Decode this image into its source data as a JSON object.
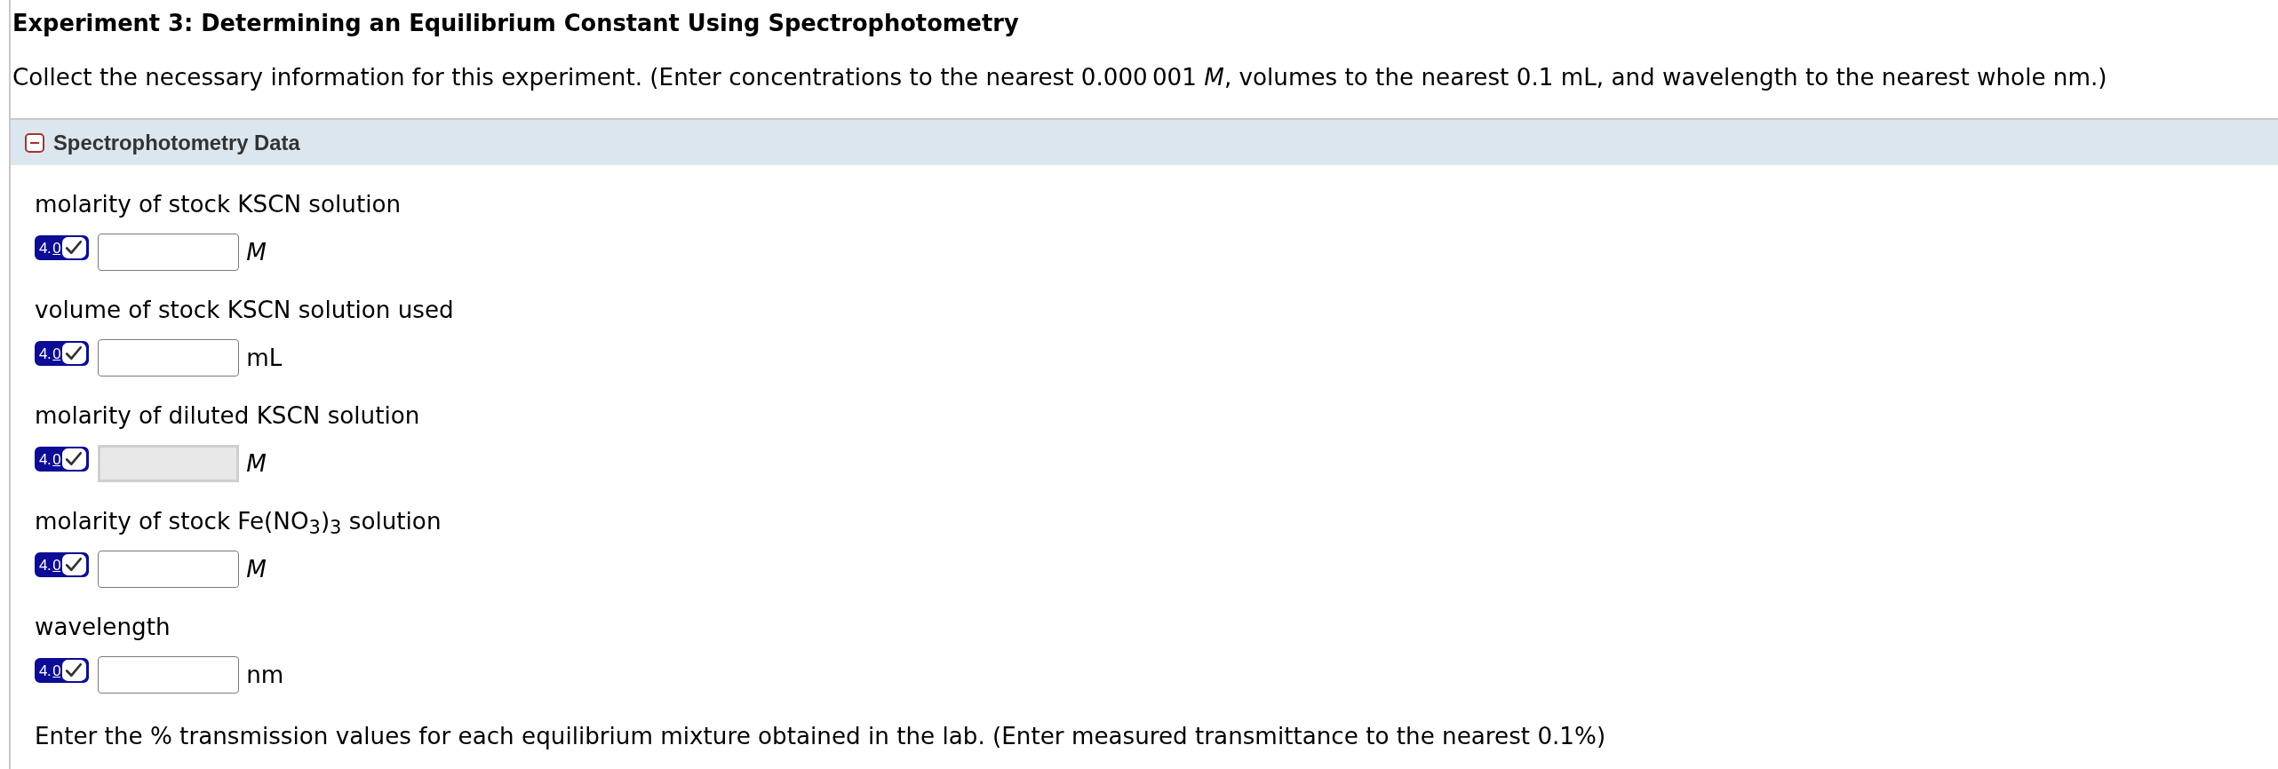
{
  "page": {
    "title": "Experiment 3: Determining an Equilibrium Constant Using Spectrophotometry",
    "instructions": "Collect the necessary information for this experiment. (Enter concentrations to the nearest 0.000 001 *M*, volumes to the nearest 0.1 mL, and wavelength to the nearest whole nm.)"
  },
  "panel": {
    "title": "Spectrophotometry Data",
    "expanded": true,
    "fields": [
      {
        "label": "molarity of stock KSCN solution",
        "badge": "4.0",
        "disabled": false,
        "unit": "M",
        "unit_italic": true
      },
      {
        "label": "volume of stock KSCN solution used",
        "badge": "4.0",
        "disabled": false,
        "unit": "mL",
        "unit_italic": false
      },
      {
        "label": "molarity of diluted KSCN solution",
        "badge": "4.0",
        "disabled": true,
        "unit": "M",
        "unit_italic": true
      },
      {
        "label": "molarity of stock Fe(NO$_{3}$)$_{3}$ solution",
        "badge": "4.0",
        "disabled": false,
        "unit": "M",
        "unit_italic": true
      },
      {
        "label": "wavelength",
        "badge": "4.0",
        "disabled": false,
        "unit": "nm",
        "unit_italic": false
      }
    ],
    "note": "Enter the % transmission values for each equilibrium mixture obtained in the lab. (Enter measured transmittance to the nearest 0.1%)"
  }
}
